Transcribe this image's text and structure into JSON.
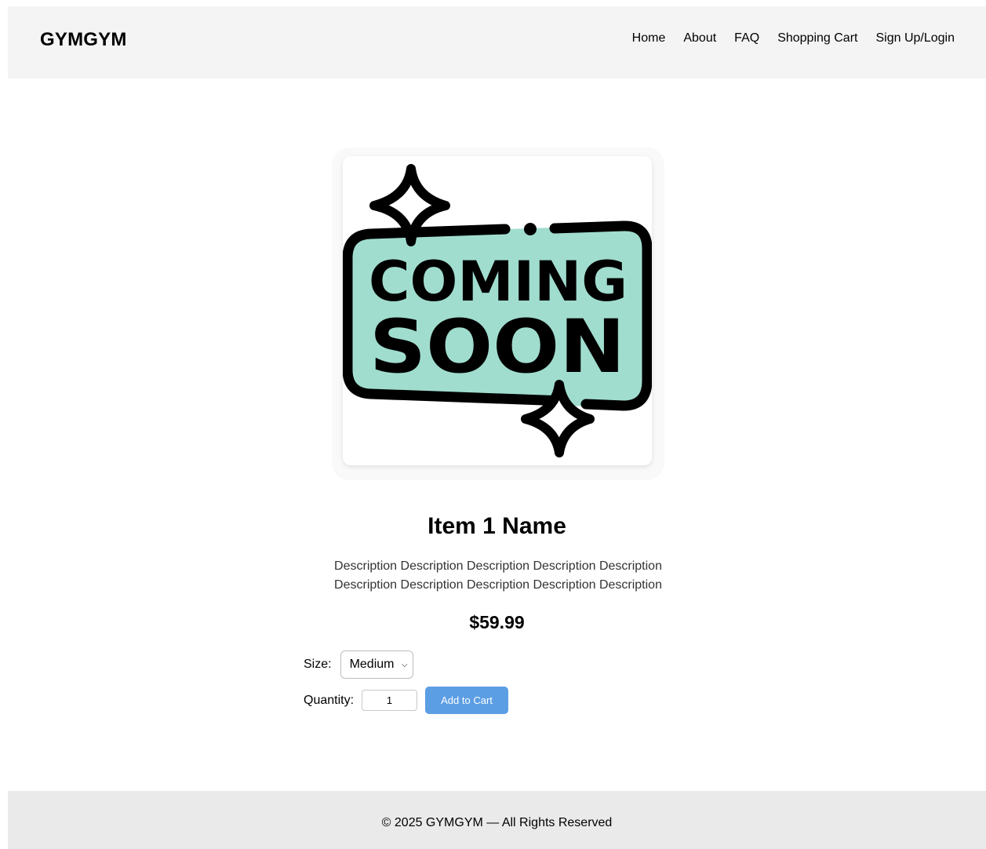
{
  "header": {
    "logo": "GYMGYM",
    "nav": [
      "Home",
      "About",
      "FAQ",
      "Shopping Cart",
      "Sign Up/Login"
    ]
  },
  "product": {
    "image_text_line1": "COMING",
    "image_text_line2": "SOON",
    "badge_color": "#a0ddcf",
    "name": "Item 1 Name",
    "description": "Description Description Description Description Description Description Description Description Description Description",
    "price": "$59.99",
    "size_label": "Size:",
    "size_selected": "Medium",
    "quantity_label": "Quantity:",
    "quantity_value": "1",
    "add_to_cart_label": "Add to Cart"
  },
  "footer": {
    "text": "© 2025 GYMGYM — All Rights Reserved"
  },
  "colors": {
    "header_bg": "#f4f4f4",
    "footer_bg": "#eaeaea",
    "button_bg": "#5b9ee4"
  }
}
